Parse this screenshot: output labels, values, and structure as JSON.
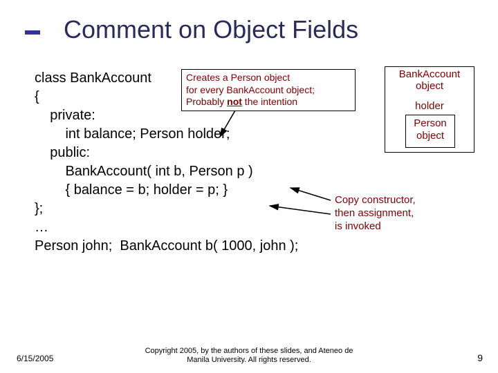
{
  "title": "Comment on Object Fields",
  "code_lines": [
    "class BankAccount",
    "{",
    "    private:",
    "        int balance; Person holder;",
    "    public:",
    "        BankAccount( int b, Person p )",
    "        { balance = b; holder = p; }",
    "};",
    "…",
    "Person john;  BankAccount b( 1000, john );"
  ],
  "callout1": {
    "l1": "Creates a Person object",
    "l2": "for every BankAccount object;",
    "l3a": "Probably ",
    "l3b": "not",
    "l3c": " the intention"
  },
  "callout2": {
    "l1": "Copy constructor,",
    "l2": "then assignment,",
    "l3": "is invoked"
  },
  "box_ba": {
    "label_l1": "BankAccount",
    "label_l2": "object",
    "holder": "holder"
  },
  "box_p": {
    "l1": "Person",
    "l2": "object"
  },
  "footer": {
    "date": "6/15/2005",
    "copy_l1": "Copyright 2005, by the authors of these slides, and Ateneo de",
    "copy_l2": "Manila University. All rights reserved.",
    "num": "9"
  }
}
